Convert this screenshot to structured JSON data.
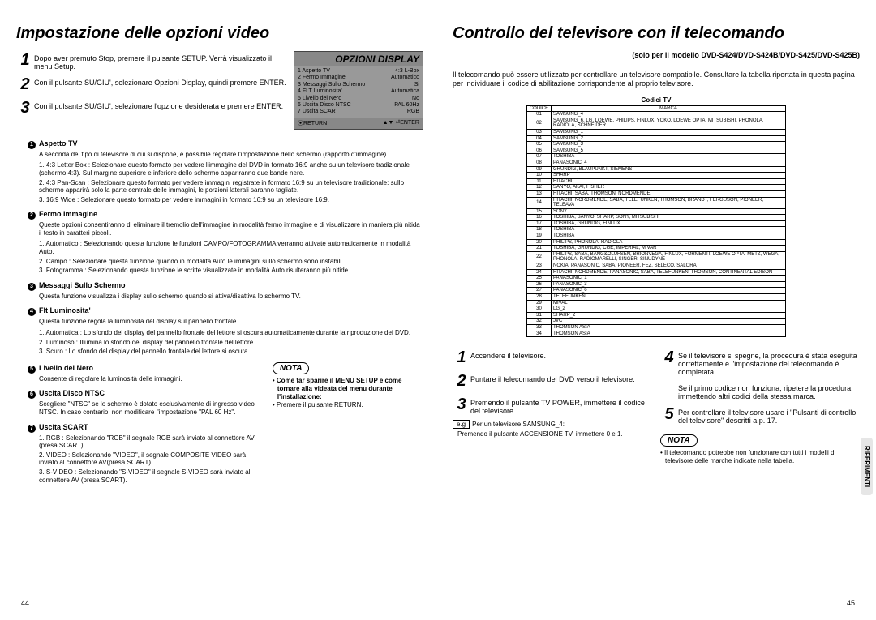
{
  "left": {
    "title": "Impostazione delle opzioni video",
    "steps": [
      "Dopo aver premuto Stop, premere il pulsante SETUP. Verrà visualizzato il menu Setup.",
      "Con il pulsante SU/GIU', selezionare Opzioni Display, quindi premere ENTER.",
      "Con il pulsante SU/GIU', selezionare l'opzione desiderata e premere ENTER."
    ],
    "display": {
      "title": "OPZIONI DISPLAY",
      "items": [
        {
          "n": "1",
          "l": "Aspetto TV",
          "r": "4:3 L-Box"
        },
        {
          "n": "2",
          "l": "Fermo Immagine",
          "r": "Automatico"
        },
        {
          "n": "3",
          "l": "Messaggi Sullo Schermo",
          "r": "Si"
        },
        {
          "n": "4",
          "l": "FLT Luminosita'",
          "r": "Automatica"
        },
        {
          "n": "5",
          "l": "Livello del Nero",
          "r": "No"
        },
        {
          "n": "6",
          "l": "Uscita Disco NTSC",
          "r": "PAL 60Hz"
        },
        {
          "n": "7",
          "l": "Uscita SCART",
          "r": "RGB"
        }
      ],
      "footer_l": "RETURN",
      "footer_r": "ENTER"
    },
    "sec1": {
      "title": "Aspetto TV",
      "desc": "A seconda del tipo di televisore di cui si dispone, è possibile regolare l'impostazione dello schermo (rapporto d'immagine).",
      "i1": "1. 4:3 Letter Box : Selezionare questo formato per vedere l'immagine del DVD in formato 16:9 anche su un televisore tradizionale (schermo 4:3). Sul margine superiore e inferiore dello schermo appariranno due bande nere.",
      "i2": "2. 4:3 Pan-Scan : Selezionare questo formato per vedere immagini registrate in formato 16:9 su un televisore tradizionale: sullo schermo apparirà solo la parte centrale delle immagini, le porzioni laterali saranno tagliate.",
      "i3": "3. 16:9 Wide : Selezionare questo formato per vedere immagini in formato 16:9 su un televisore 16:9."
    },
    "sec2": {
      "title": "Fermo Immagine",
      "desc": "Queste opzioni consentiranno di eliminare il tremolio dell'immagine in modalità fermo immagine e di visualizzare in maniera più nitida il testo in caratteri piccoli.",
      "i1": "1. Automatico : Selezionando questa funzione le funzioni CAMPO/FOTOGRAMMA verranno attivate automaticamente in modalità Auto.",
      "i2": "2. Campo : Selezionare questa funzione quando in modalità Auto le immagini sullo schermo sono instabili.",
      "i3": "3. Fotogramma : Selezionando questa funzione le scritte visualizzate in modalità Auto risulteranno più nitide."
    },
    "sec3": {
      "title": "Messaggi Sullo Schermo",
      "desc": "Questa funzione visualizza i display sullo schermo quando si attiva/disattiva lo schermo TV."
    },
    "sec4": {
      "title": "Flt Luminosita'",
      "desc": "Questa funzione regola la luminosità del display sul pannello frontale.",
      "i1": "1. Automatica : Lo sfondo del display del pannello frontale del lettore si oscura automaticamente durante la riproduzione dei DVD.",
      "i2": "2. Luminoso : Illumina lo sfondo del display del pannello frontale del lettore.",
      "i3": "3. Scuro : Lo sfondo del display del pannello frontale del lettore si oscura."
    },
    "sec5": {
      "title": "Livello del Nero",
      "desc": "Consente di regolare la luminosità delle immagini."
    },
    "sec6": {
      "title": "Uscita Disco NTSC",
      "desc": "Scegliere \"NTSC\" se lo schermo è dotato esclusivamente di ingresso video NTSC. In caso contrario, non modificare l'impostazione \"PAL 60 Hz\"."
    },
    "sec7": {
      "title": "Uscita SCART",
      "i1": "1. RGB : Selezionando \"RGB\" il segnale RGB sarà inviato al connettore AV (presa SCART).",
      "i2": "2. VIDEO : Selezionando \"VIDEO\", il segnale COMPOSITE VIDEO sarà inviato al connettore AV(presa SCART).",
      "i3": "3. S-VIDEO : Selezionando \"S-VIDEO\" il segnale S-VIDEO sarà inviato al connettore AV (presa SCART)."
    },
    "nota": "NOTA",
    "nota_items": [
      "Come far sparire il MENU SETUP e come tornare alla videata del menu durante l'installazione:",
      "Premere il pulsante RETURN."
    ],
    "pagenum": "44"
  },
  "right": {
    "title": "Controllo del televisore con il telecomando",
    "subtitle": "(solo per il modello DVD-S424/DVD-S424B/DVD-S425/DVD-S425B)",
    "intro": "Il telecomando può essere utilizzato per controllare un televisore compatibile. Consultare la tabella riportata in questa pagina per individuare il codice di abilitazione corrispondente al proprio televisore.",
    "table_title": "Codici TV",
    "th1": "CODICE",
    "th2": "MARCA",
    "rows": [
      [
        "01",
        "SAMSUNG_4"
      ],
      [
        "02",
        "SAMSUNG_6, LG, LOEWE, PHILIPS, FINLUX, YOKO, LOEWE OPTA, MITSUBISHI, PHONOLA, RADIOLA, SCHNEIDER"
      ],
      [
        "03",
        "SAMSUNG_1"
      ],
      [
        "04",
        "SAMSUNG_2"
      ],
      [
        "05",
        "SAMSUNG_3"
      ],
      [
        "06",
        "SAMSUNG_5"
      ],
      [
        "07",
        "TOSHIBA"
      ],
      [
        "08",
        "PANASONIC_4"
      ],
      [
        "09",
        "GRUNDIG, BLAUPUNKT, SIEMENS"
      ],
      [
        "10",
        "SHARP"
      ],
      [
        "11",
        "HITACHI"
      ],
      [
        "12",
        "SANYO, AKAI, FISHER"
      ],
      [
        "13",
        "HITACHI, SABA, THOMSON, NORDMENDE"
      ],
      [
        "14",
        "HITACHI, NORDMENDE, SABA, TELEFUNKEN, THOMSON, BRANDT, FERGUSON, PIONEER, TELEAVA"
      ],
      [
        "15",
        "SONY"
      ],
      [
        "16",
        "TOSHIBA, SANYO, SHARP, SONY, MITSUBISHI"
      ],
      [
        "17",
        "TOSHIBA, GRUNDIG, FINLUX"
      ],
      [
        "18",
        "TOSHIBA"
      ],
      [
        "19",
        "TOSHIBA"
      ],
      [
        "20",
        "PHILIPS, PHONOLA, RADIOLA"
      ],
      [
        "21",
        "TOSHIBA, GRUNDIG, CGE, IMPERIAL, MIVAR"
      ],
      [
        "22",
        "PHILIPS, SABA, BANG&OLUFSEN, BRIONVEGA, FINLUX, FORMENTI, LOEWE OPTA, METZ, WEGA, PHONOLA, RADIOMARELLI, SINGER, SINUDYNE"
      ],
      [
        "23",
        "NOKIA, PANASONIC, SABA, PIONEER, FEZ, SELECO, SALORA"
      ],
      [
        "24",
        "HITACHI, NORDMENDE, PANASONIC, SABA, TELEFUNKEN, THOMSON, CONTINENTAL EDISON"
      ],
      [
        "25",
        "PANASONIC_1"
      ],
      [
        "26",
        "PANASONIC_3"
      ],
      [
        "27",
        "PANASONIC_6"
      ],
      [
        "28",
        "TELEFUNKEN"
      ],
      [
        "29",
        "MIVAL"
      ],
      [
        "30",
        "LG_2"
      ],
      [
        "31",
        "SHARP_2"
      ],
      [
        "32",
        "JVC"
      ],
      [
        "33",
        "THOMSON ASIA"
      ],
      [
        "34",
        "THOMSON ASIA"
      ]
    ],
    "steps": [
      "Accendere il televisore.",
      "Puntare il telecomando del DVD verso il televisore.",
      "Premendo il pulsante TV POWER, immettere il codice del televisore.",
      "Se il televisore si spegne, la procedura è stata eseguita correttamente e l'impostazione del telecomando è completata.",
      "Per controllare il televisore usare i \"Pulsanti di controllo del televisore\" descritti a p. 17."
    ],
    "step4_extra": "Se il primo codice non funziona, ripetere la procedura immettendo altri codici della stessa marca.",
    "eg_label": "e.g",
    "eg_text": "Per un televisore SAMSUNG_4:",
    "eg_sub": "Premendo il pulsante ACCENSIONE TV, immettere 0 e 1.",
    "nota": "NOTA",
    "nota_item": "Il telecomando potrebbe non funzionare con tutti i modelli di televisore delle marche indicate nella tabella.",
    "sidetab": "RIFERIMENTI",
    "pagenum": "45"
  }
}
